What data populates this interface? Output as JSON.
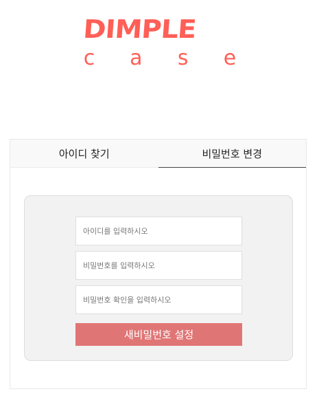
{
  "logo": {
    "word": "DIMPLE",
    "sub": [
      "c",
      "a",
      "s",
      "e"
    ],
    "color": "#ff5f57"
  },
  "tabs": [
    {
      "label": "아이디 찾기",
      "active": false
    },
    {
      "label": "비밀번호 변경",
      "active": true
    }
  ],
  "form": {
    "id_placeholder": "아이디를 입력하시오",
    "password_placeholder": "비밀번호를 입력하시오",
    "confirm_placeholder": "비밀번호 확인을 입력하시오",
    "submit_label": "새비밀번호 설정",
    "submit_color": "#e07575"
  }
}
